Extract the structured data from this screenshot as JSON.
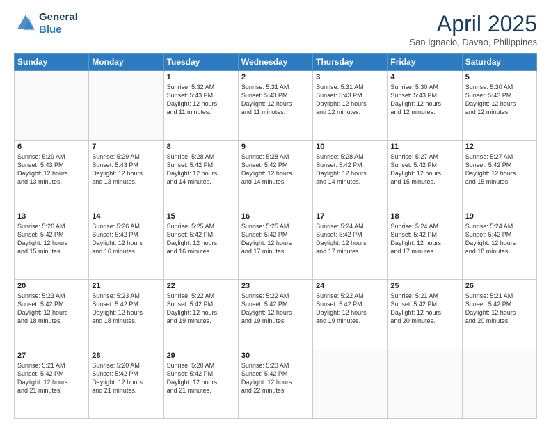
{
  "header": {
    "logo_line1": "General",
    "logo_line2": "Blue",
    "month": "April 2025",
    "location": "San Ignacio, Davao, Philippines"
  },
  "weekdays": [
    "Sunday",
    "Monday",
    "Tuesday",
    "Wednesday",
    "Thursday",
    "Friday",
    "Saturday"
  ],
  "weeks": [
    [
      {
        "day": "",
        "sunrise": "",
        "sunset": "",
        "daylight": ""
      },
      {
        "day": "",
        "sunrise": "",
        "sunset": "",
        "daylight": ""
      },
      {
        "day": "1",
        "sunrise": "Sunrise: 5:32 AM",
        "sunset": "Sunset: 5:43 PM",
        "daylight": "Daylight: 12 hours and 11 minutes."
      },
      {
        "day": "2",
        "sunrise": "Sunrise: 5:31 AM",
        "sunset": "Sunset: 5:43 PM",
        "daylight": "Daylight: 12 hours and 11 minutes."
      },
      {
        "day": "3",
        "sunrise": "Sunrise: 5:31 AM",
        "sunset": "Sunset: 5:43 PM",
        "daylight": "Daylight: 12 hours and 12 minutes."
      },
      {
        "day": "4",
        "sunrise": "Sunrise: 5:30 AM",
        "sunset": "Sunset: 5:43 PM",
        "daylight": "Daylight: 12 hours and 12 minutes."
      },
      {
        "day": "5",
        "sunrise": "Sunrise: 5:30 AM",
        "sunset": "Sunset: 5:43 PM",
        "daylight": "Daylight: 12 hours and 12 minutes."
      }
    ],
    [
      {
        "day": "6",
        "sunrise": "Sunrise: 5:29 AM",
        "sunset": "Sunset: 5:43 PM",
        "daylight": "Daylight: 12 hours and 13 minutes."
      },
      {
        "day": "7",
        "sunrise": "Sunrise: 5:29 AM",
        "sunset": "Sunset: 5:43 PM",
        "daylight": "Daylight: 12 hours and 13 minutes."
      },
      {
        "day": "8",
        "sunrise": "Sunrise: 5:28 AM",
        "sunset": "Sunset: 5:42 PM",
        "daylight": "Daylight: 12 hours and 14 minutes."
      },
      {
        "day": "9",
        "sunrise": "Sunrise: 5:28 AM",
        "sunset": "Sunset: 5:42 PM",
        "daylight": "Daylight: 12 hours and 14 minutes."
      },
      {
        "day": "10",
        "sunrise": "Sunrise: 5:28 AM",
        "sunset": "Sunset: 5:42 PM",
        "daylight": "Daylight: 12 hours and 14 minutes."
      },
      {
        "day": "11",
        "sunrise": "Sunrise: 5:27 AM",
        "sunset": "Sunset: 5:42 PM",
        "daylight": "Daylight: 12 hours and 15 minutes."
      },
      {
        "day": "12",
        "sunrise": "Sunrise: 5:27 AM",
        "sunset": "Sunset: 5:42 PM",
        "daylight": "Daylight: 12 hours and 15 minutes."
      }
    ],
    [
      {
        "day": "13",
        "sunrise": "Sunrise: 5:26 AM",
        "sunset": "Sunset: 5:42 PM",
        "daylight": "Daylight: 12 hours and 15 minutes."
      },
      {
        "day": "14",
        "sunrise": "Sunrise: 5:26 AM",
        "sunset": "Sunset: 5:42 PM",
        "daylight": "Daylight: 12 hours and 16 minutes."
      },
      {
        "day": "15",
        "sunrise": "Sunrise: 5:25 AM",
        "sunset": "Sunset: 5:42 PM",
        "daylight": "Daylight: 12 hours and 16 minutes."
      },
      {
        "day": "16",
        "sunrise": "Sunrise: 5:25 AM",
        "sunset": "Sunset: 5:42 PM",
        "daylight": "Daylight: 12 hours and 17 minutes."
      },
      {
        "day": "17",
        "sunrise": "Sunrise: 5:24 AM",
        "sunset": "Sunset: 5:42 PM",
        "daylight": "Daylight: 12 hours and 17 minutes."
      },
      {
        "day": "18",
        "sunrise": "Sunrise: 5:24 AM",
        "sunset": "Sunset: 5:42 PM",
        "daylight": "Daylight: 12 hours and 17 minutes."
      },
      {
        "day": "19",
        "sunrise": "Sunrise: 5:24 AM",
        "sunset": "Sunset: 5:42 PM",
        "daylight": "Daylight: 12 hours and 18 minutes."
      }
    ],
    [
      {
        "day": "20",
        "sunrise": "Sunrise: 5:23 AM",
        "sunset": "Sunset: 5:42 PM",
        "daylight": "Daylight: 12 hours and 18 minutes."
      },
      {
        "day": "21",
        "sunrise": "Sunrise: 5:23 AM",
        "sunset": "Sunset: 5:42 PM",
        "daylight": "Daylight: 12 hours and 18 minutes."
      },
      {
        "day": "22",
        "sunrise": "Sunrise: 5:22 AM",
        "sunset": "Sunset: 5:42 PM",
        "daylight": "Daylight: 12 hours and 19 minutes."
      },
      {
        "day": "23",
        "sunrise": "Sunrise: 5:22 AM",
        "sunset": "Sunset: 5:42 PM",
        "daylight": "Daylight: 12 hours and 19 minutes."
      },
      {
        "day": "24",
        "sunrise": "Sunrise: 5:22 AM",
        "sunset": "Sunset: 5:42 PM",
        "daylight": "Daylight: 12 hours and 19 minutes."
      },
      {
        "day": "25",
        "sunrise": "Sunrise: 5:21 AM",
        "sunset": "Sunset: 5:42 PM",
        "daylight": "Daylight: 12 hours and 20 minutes."
      },
      {
        "day": "26",
        "sunrise": "Sunrise: 5:21 AM",
        "sunset": "Sunset: 5:42 PM",
        "daylight": "Daylight: 12 hours and 20 minutes."
      }
    ],
    [
      {
        "day": "27",
        "sunrise": "Sunrise: 5:21 AM",
        "sunset": "Sunset: 5:42 PM",
        "daylight": "Daylight: 12 hours and 21 minutes."
      },
      {
        "day": "28",
        "sunrise": "Sunrise: 5:20 AM",
        "sunset": "Sunset: 5:42 PM",
        "daylight": "Daylight: 12 hours and 21 minutes."
      },
      {
        "day": "29",
        "sunrise": "Sunrise: 5:20 AM",
        "sunset": "Sunset: 5:42 PM",
        "daylight": "Daylight: 12 hours and 21 minutes."
      },
      {
        "day": "30",
        "sunrise": "Sunrise: 5:20 AM",
        "sunset": "Sunset: 5:42 PM",
        "daylight": "Daylight: 12 hours and 22 minutes."
      },
      {
        "day": "",
        "sunrise": "",
        "sunset": "",
        "daylight": ""
      },
      {
        "day": "",
        "sunrise": "",
        "sunset": "",
        "daylight": ""
      },
      {
        "day": "",
        "sunrise": "",
        "sunset": "",
        "daylight": ""
      }
    ]
  ]
}
